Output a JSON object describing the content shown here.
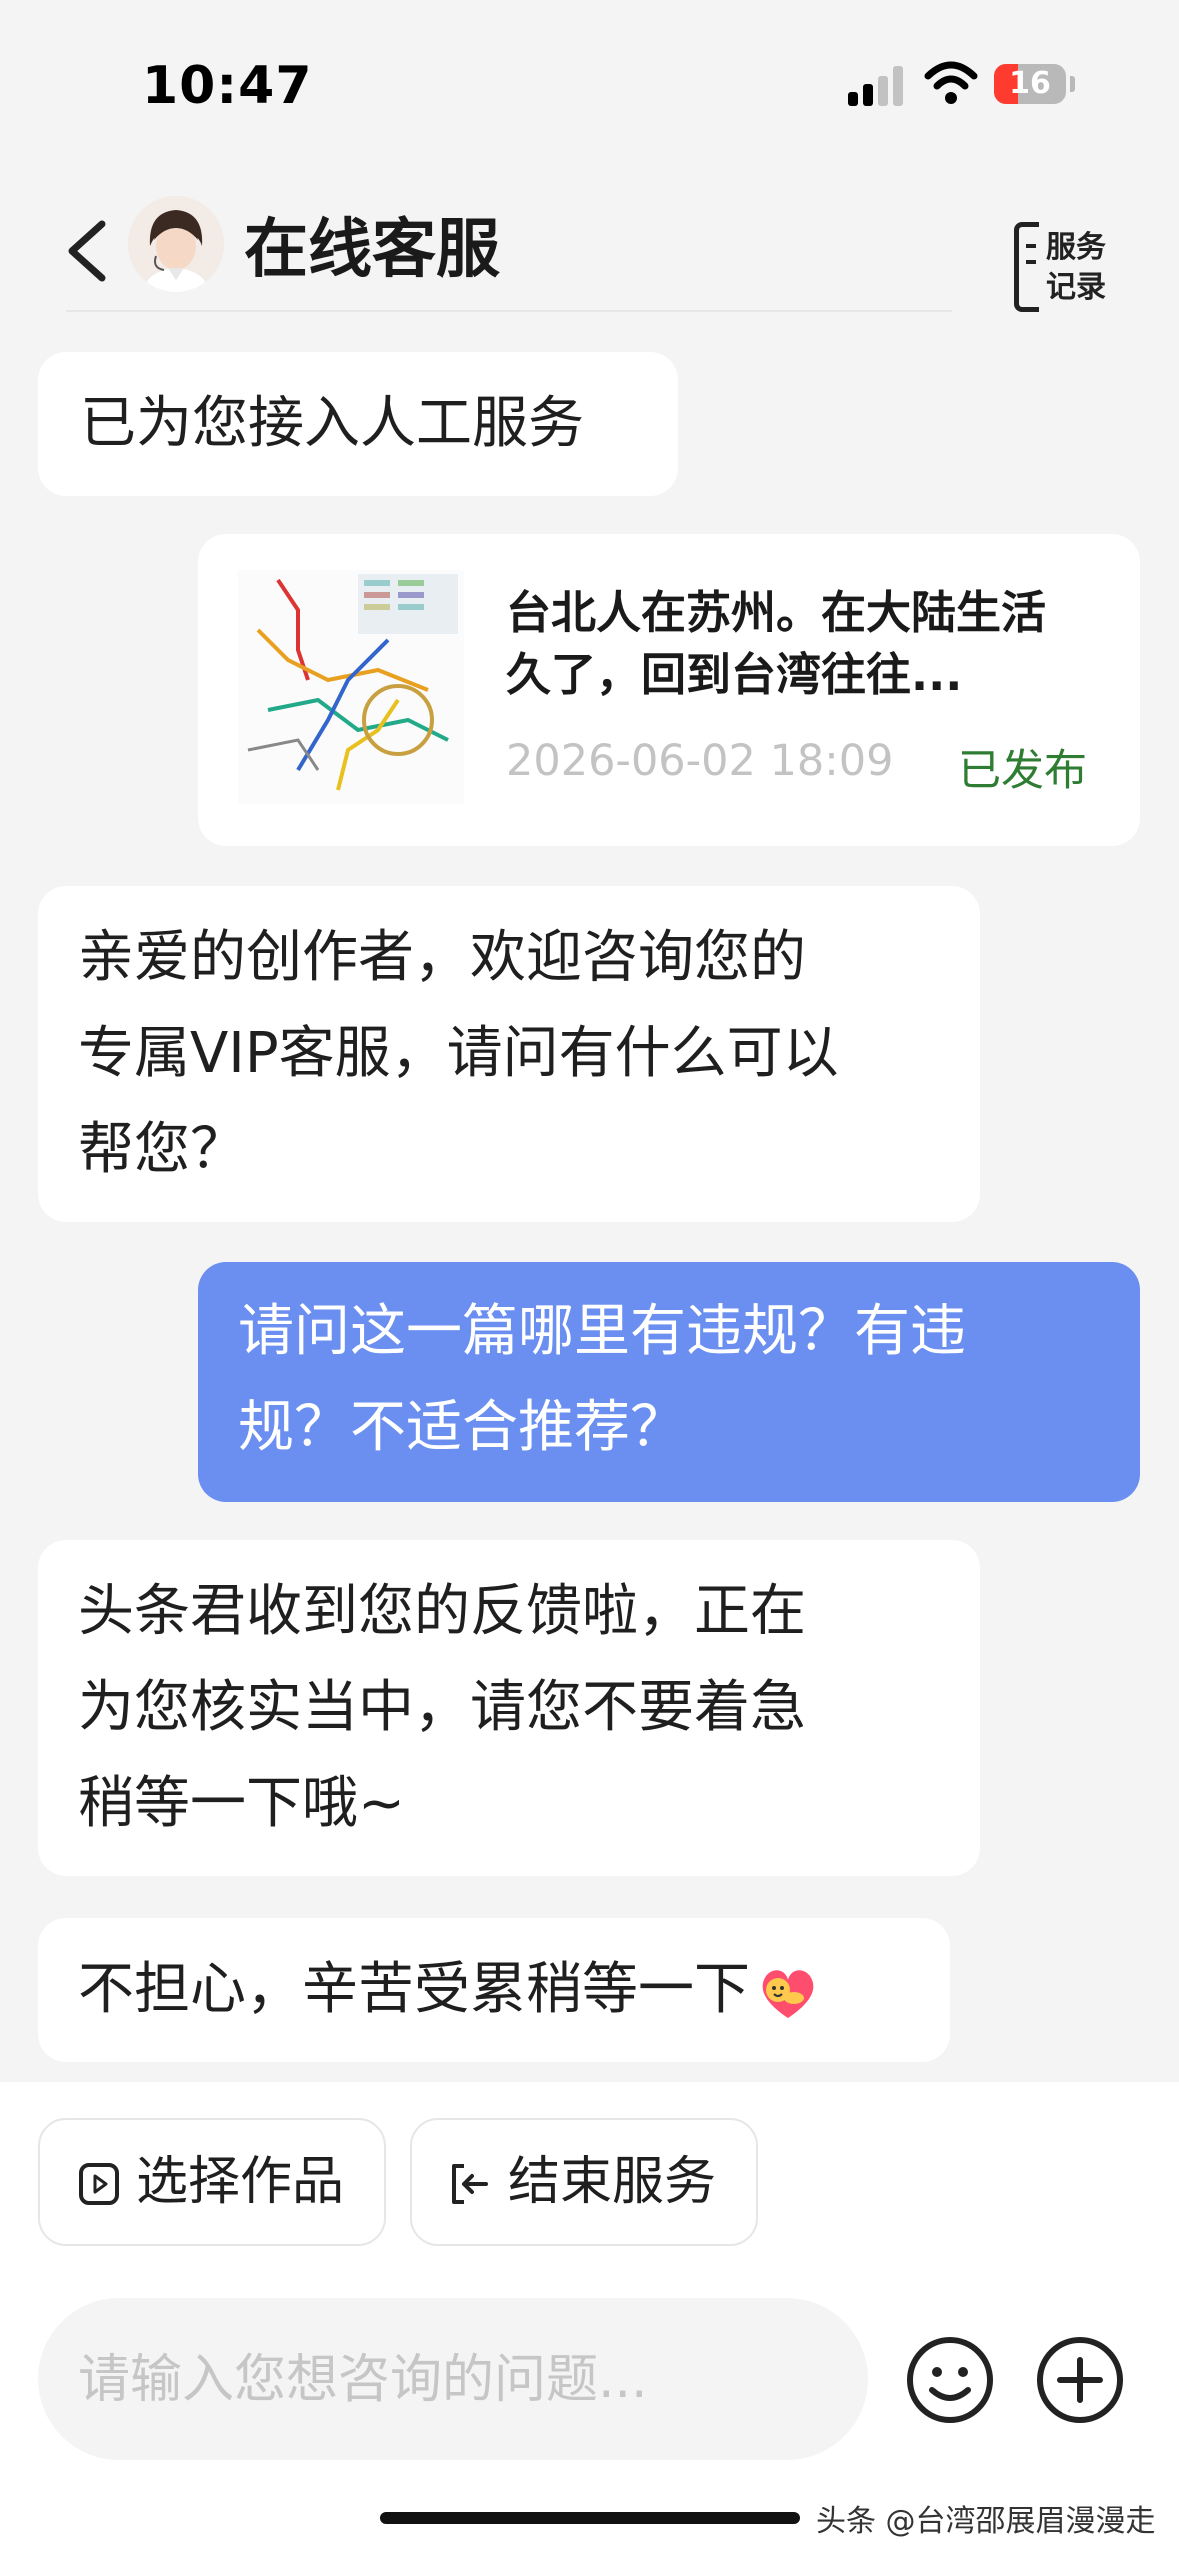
{
  "status_bar": {
    "time": "10:47",
    "battery": "16"
  },
  "header": {
    "title": "在线客服",
    "service_record_line1": "服务",
    "service_record_line2": "记录"
  },
  "messages": {
    "system_connected": "已为您接入人工服务",
    "article_card": {
      "title": "台北人在苏州。在大陆生活久了，回到台湾往往...",
      "date": "2026-06-02 18:09",
      "status": "已发布"
    },
    "agent_welcome_lines": [
      "亲爱的创作者，欢迎咨询您的",
      "专属VIP客服，请问有什么可以",
      "帮您？"
    ],
    "user_question_lines": [
      "请问这一篇哪里有违规？有违",
      "规？不适合推荐？"
    ],
    "agent_reply_lines": [
      "头条君收到您的反馈啦，正在",
      "为您核实当中，请您不要着急",
      "稍等一下哦~"
    ],
    "user_reply": "不担心，辛苦受累稍等一下"
  },
  "actions": {
    "select_work": "选择作品",
    "end_service": "结束服务"
  },
  "input": {
    "placeholder": "请输入您想咨询的问题..."
  },
  "watermark": "头条 @台湾邵展眉漫漫走",
  "colors": {
    "user_bubble": "#6a8ff0",
    "published_status": "#2e7d32",
    "background": "#f4f4f4"
  }
}
